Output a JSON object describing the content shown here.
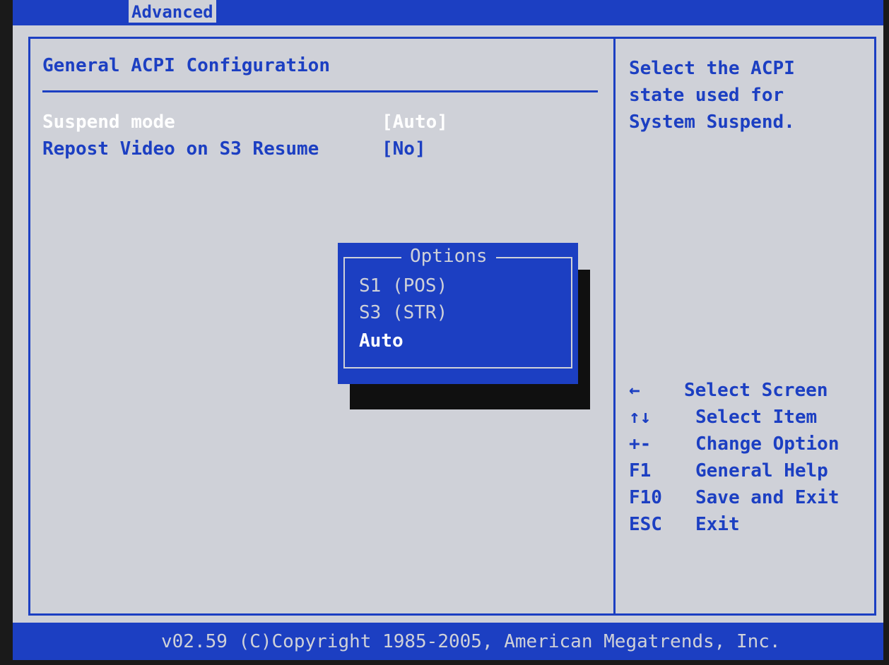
{
  "tabs": {
    "active": "Advanced"
  },
  "section": {
    "title": "General ACPI Configuration"
  },
  "settings": [
    {
      "label": "Suspend mode",
      "value": "[Auto]"
    },
    {
      "label": "Repost Video on S3 Resume",
      "value": "[No]"
    }
  ],
  "help_text": [
    "Select the ACPI",
    "state used for",
    "System Suspend."
  ],
  "popup": {
    "title": "Options",
    "options": [
      "S1 (POS)",
      "S3 (STR)",
      "Auto"
    ]
  },
  "key_legend": [
    {
      "key": "←",
      "desc": "Select Screen"
    },
    {
      "key": "↑↓",
      "desc": "Select Item"
    },
    {
      "key": "+-",
      "desc": "Change Option"
    },
    {
      "key": "F1",
      "desc": "General Help"
    },
    {
      "key": "F10",
      "desc": "Save and Exit"
    },
    {
      "key": "ESC",
      "desc": "Exit"
    }
  ],
  "footer": {
    "copyright": "v02.59 (C)Copyright 1985-2005, American Megatrends, Inc."
  },
  "colors": {
    "accent": "#1c3fc2",
    "background": "#cfd1d8",
    "highlight": "#ffffff"
  }
}
